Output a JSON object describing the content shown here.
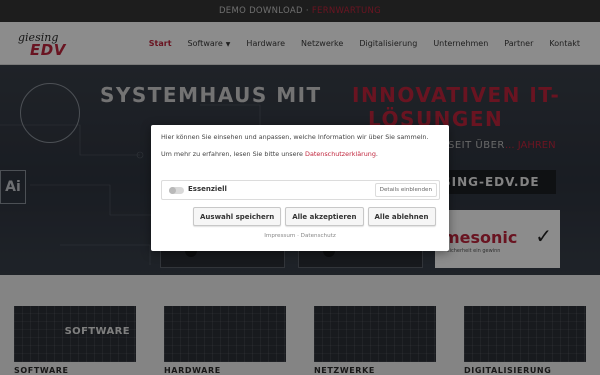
{
  "topbar": {
    "text": "DEMO DOWNLOAD",
    "separator": "·",
    "highlight": "FERNWARTUNG"
  },
  "nav": {
    "logo_top": "giesing",
    "logo_bottom": "EDV",
    "items": [
      {
        "label": "Start",
        "active": true
      },
      {
        "label": "Software",
        "dropdown": true
      },
      {
        "label": "Hardware"
      },
      {
        "label": "Netzwerke"
      },
      {
        "label": "Digitalisierung"
      },
      {
        "label": "Unternehmen"
      },
      {
        "label": "Partner"
      },
      {
        "label": "Kontakt"
      }
    ]
  },
  "hero": {
    "title_part1": "SYSTEMHAUS MIT",
    "title_part2": "INNOVATIVEN IT-",
    "title_part3": "LÖSUNGEN",
    "since": "SEIT ÜBER",
    "since_highlight": "... JAHREN",
    "domain": "SING-EDV.DE",
    "partner_name": "mesonic",
    "partner_tagline": "sicherheit ein gewinn",
    "ai_label": "Ai"
  },
  "categories": [
    {
      "label": "SOFTWARE",
      "tile_text": "SOFTWARE"
    },
    {
      "label": "HARDWARE",
      "tile_text": ""
    },
    {
      "label": "NETZWERKE",
      "tile_text": ""
    },
    {
      "label": "DIGITALISIERUNG",
      "tile_text": ""
    }
  ],
  "cookie": {
    "intro": "Hier können Sie einsehen und anpassen, welche Information wir über Sie sammeln.",
    "more_prefix": "Um mehr zu erfahren, lesen Sie bitte unsere",
    "privacy_link": "Datenschutzerklärung",
    "more_suffix": ".",
    "essential_label": "Essenziell",
    "details_button": "Details einblenden",
    "save_button": "Auswahl speichern",
    "accept_button": "Alle akzeptieren",
    "reject_button": "Alle ablehnen",
    "imprint": "Impressum",
    "footer_sep": "·",
    "privacy": "Datenschutz"
  },
  "colors": {
    "accent": "#c0253c",
    "topbar": "#363636"
  }
}
